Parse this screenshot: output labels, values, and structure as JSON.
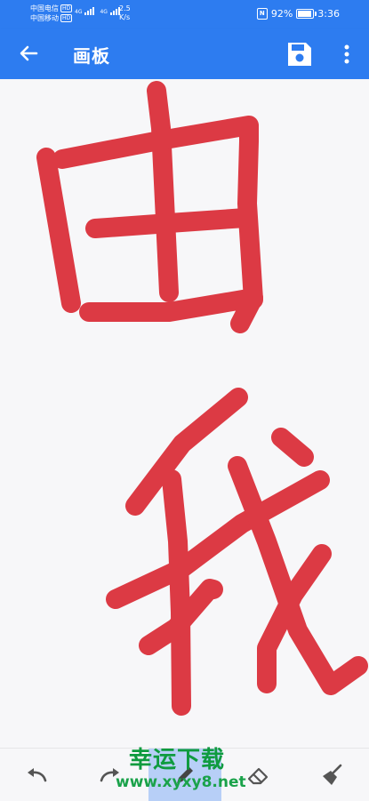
{
  "status_bar": {
    "carrier1": "中国电信",
    "carrier2": "中国移动",
    "hd": "HD",
    "net1": "4G",
    "net2": "4G",
    "speed_value": "2.5",
    "speed_unit": "K/s",
    "nfc": "N",
    "battery": "92%",
    "battery_level": 0.92,
    "time": "3:36"
  },
  "app_bar": {
    "title": "画板",
    "back_icon": "arrow-back-icon",
    "save_icon": "save-floppy-icon",
    "more_icon": "more-vert-icon"
  },
  "canvas": {
    "stroke_color": "#dc3a44",
    "drawing_text": "由我"
  },
  "toolbar": {
    "tools": [
      "undo-icon",
      "redo-icon",
      "pen-icon",
      "eraser-icon",
      "broom-clear-icon"
    ],
    "active_tool": "pen-icon"
  },
  "watermark": {
    "title": "幸运下载",
    "url": "www.xyxy8.net"
  },
  "colors": {
    "accent": "#2d7cf0",
    "canvas_bg": "#f7f7f9",
    "active_tool_bg": "#b7cff7"
  }
}
